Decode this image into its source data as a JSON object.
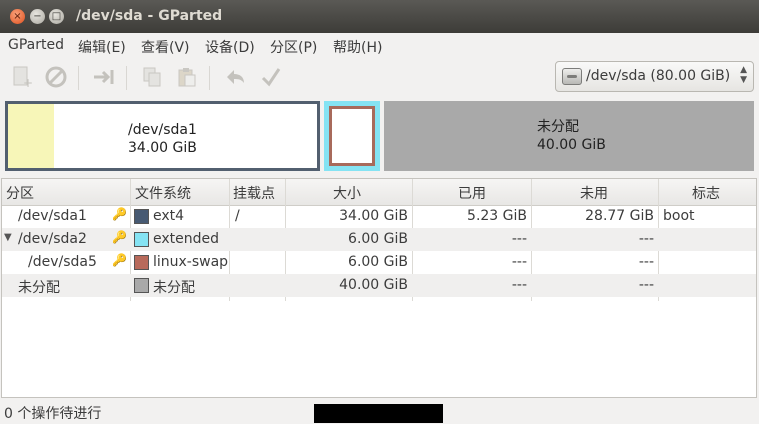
{
  "window": {
    "title": "/dev/sda - GParted"
  },
  "menu": [
    "GParted",
    "编辑(E)",
    "查看(V)",
    "设备(D)",
    "分区(P)",
    "帮助(H)"
  ],
  "toolbar": {
    "icons": [
      "new-partition-icon",
      "delete-partition-icon",
      "resize-move-icon",
      "copy-icon",
      "paste-icon",
      "undo-icon",
      "apply-icon"
    ]
  },
  "device_selector": {
    "text": "/dev/sda   (80.00 GiB)"
  },
  "disk_map": {
    "sda1": {
      "name": "/dev/sda1",
      "size": "34.00 GiB",
      "used_fraction": 0.15
    },
    "unallocated": {
      "name": "未分配",
      "size": "40.00 GiB"
    }
  },
  "table": {
    "headers": [
      "分区",
      "文件系统",
      "挂载点",
      "大小",
      "已用",
      "未用",
      "标志"
    ],
    "rows": [
      {
        "partition": "/dev/sda1",
        "fs": "ext4",
        "fs_color": "#475a73",
        "mount": "/",
        "size": "34.00 GiB",
        "used": "5.23 GiB",
        "unused": "28.77 GiB",
        "flags": "boot",
        "key": true
      },
      {
        "partition": "/dev/sda2",
        "fs": "extended",
        "fs_color": "#85e3f3",
        "mount": "",
        "size": "6.00 GiB",
        "used": "---",
        "unused": "---",
        "flags": "",
        "key": true,
        "expander": "▼"
      },
      {
        "partition": "/dev/sda5",
        "fs": "linux-swap",
        "fs_color": "#b86a5b",
        "mount": "",
        "size": "6.00 GiB",
        "used": "---",
        "unused": "---",
        "flags": "",
        "key": true
      },
      {
        "partition": "未分配",
        "fs": "未分配",
        "fs_color": "#a9a9a9",
        "mount": "",
        "size": "40.00 GiB",
        "used": "---",
        "unused": "---",
        "flags": "",
        "key": false
      }
    ]
  },
  "status": {
    "text": "0 个操作待进行"
  }
}
